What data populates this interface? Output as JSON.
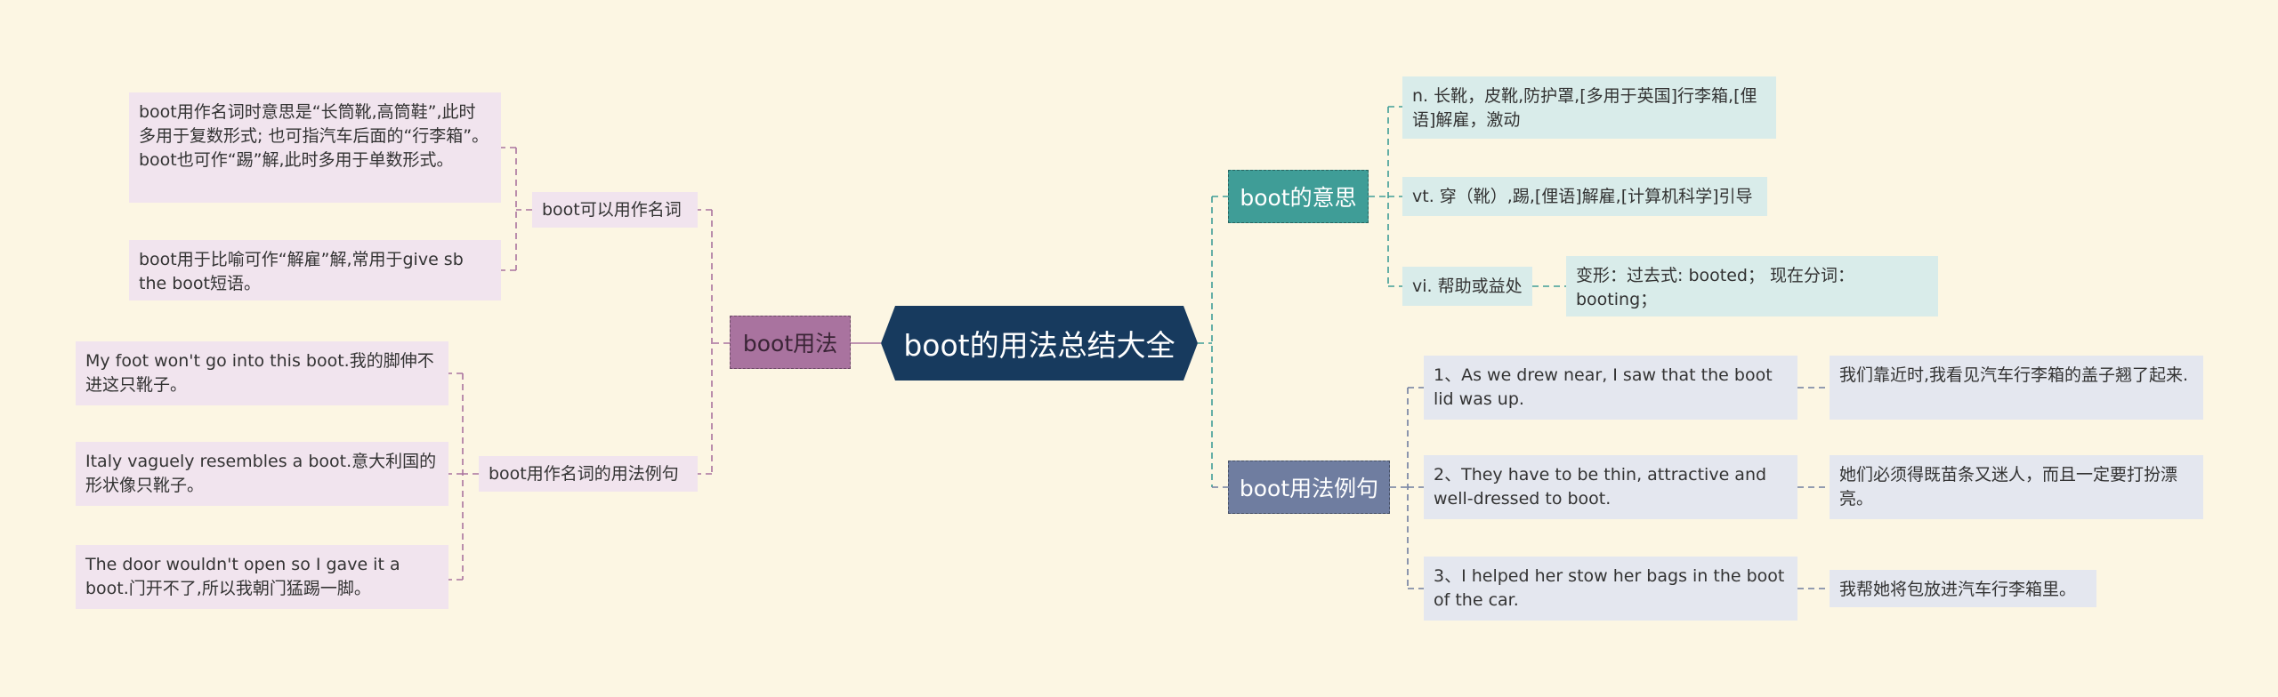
{
  "root": {
    "title": "boot的用法总结大全"
  },
  "left": {
    "branch_label": "boot用法",
    "groups": [
      {
        "label": "boot可以用作名词",
        "items": [
          "boot用作名词时意思是“长筒靴,高筒鞋”,此时多用于复数形式; 也可指汽车后面的“行李箱”。boot也可作“踢”解,此时多用于单数形式。",
          "boot用于比喻可作“解雇”解,常用于give sb the boot短语。"
        ]
      },
      {
        "label": "boot用作名词的用法例句",
        "items": [
          "My foot won't go into this boot.我的脚伸不进这只靴子。",
          "Italy vaguely resembles a boot.意大利国的形状像只靴子。",
          "The door wouldn't open so I gave it a boot.门开不了,所以我朝门猛踢一脚。"
        ]
      }
    ]
  },
  "right": {
    "meaning": {
      "branch_label": "boot的意思",
      "items": [
        "n. 长靴，皮靴,防护罩,[多用于英国]行李箱,[俚语]解雇，激动",
        "vt. 穿（靴）,踢,[俚语]解雇,[计算机科学]引导",
        "vi. 帮助或益处"
      ],
      "vi_detail": "变形：过去式: booted； 现在分词：booting；"
    },
    "examples": {
      "branch_label": "boot用法例句",
      "items": [
        {
          "en": "1、As we drew near, I saw that the boot lid was up.",
          "zh": "我们靠近时,我看见汽车行李箱的盖子翘了起来."
        },
        {
          "en": "2、They have to be thin, attractive and well-dressed to boot.",
          "zh": "她们必须得既苗条又迷人，而且一定要打扮漂亮。"
        },
        {
          "en": "3、I helped her stow her bags in the boot of the car.",
          "zh": "我帮她将包放进汽车行李箱里。"
        }
      ]
    }
  }
}
